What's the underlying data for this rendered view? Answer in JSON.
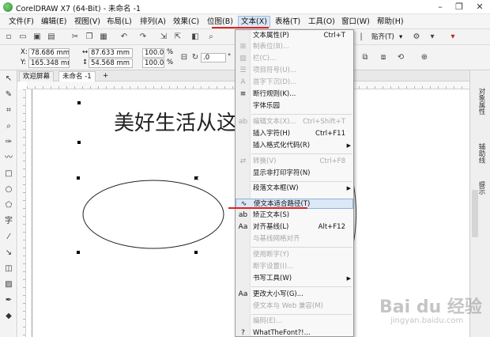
{
  "window": {
    "title": "CorelDRAW X7 (64-Bit) - 未命名 -1",
    "minimize_glyph": "–",
    "restore_glyph": "❐",
    "close_glyph": "✕"
  },
  "menubar": {
    "items": [
      {
        "label": "文件(F)"
      },
      {
        "label": "编辑(E)"
      },
      {
        "label": "视图(V)"
      },
      {
        "label": "布局(L)"
      },
      {
        "label": "排列(A)"
      },
      {
        "label": "效果(C)"
      },
      {
        "label": "位图(B)"
      },
      {
        "label": "文本(X)"
      },
      {
        "label": "表格(T)"
      },
      {
        "label": "工具(O)"
      },
      {
        "label": "窗口(W)"
      },
      {
        "label": "帮助(H)"
      }
    ],
    "active_index": 7
  },
  "toolbar": {
    "icons": [
      "new-icon",
      "open-icon",
      "save-icon",
      "print-icon",
      "cut-icon",
      "copy-icon",
      "paste-icon",
      "undo-icon",
      "redo-icon",
      "import-icon",
      "export-icon",
      "app-launcher-icon",
      "zoom-icon"
    ],
    "snap_label": "贴齐(T)",
    "snap_arrow": "▾"
  },
  "property_bar": {
    "x_label": "X:",
    "x_value": "78.686 mm",
    "y_label": "Y:",
    "y_value": "165.348 mm",
    "w_value": "87.633 mm",
    "h_value": "54.568 mm",
    "scale_w": "100.0",
    "scale_h": "100.0",
    "percent": "%",
    "rotation": ".0",
    "degree": "°"
  },
  "tabs": [
    {
      "label": "欢迎屏幕"
    },
    {
      "label": "未命名 -1"
    }
  ],
  "add_tab_glyph": "+",
  "canvas": {
    "art_text": "美好生活从这",
    "x_marker": "×"
  },
  "docker": {
    "tabs": [
      "对象属性",
      "辅助线",
      "提示"
    ]
  },
  "text_menu": {
    "items": [
      {
        "label": "文本属性(P)",
        "shortcut": "Ctrl+T",
        "disabled": false,
        "icon": ""
      },
      {
        "label": "制表位(B)...",
        "shortcut": "",
        "disabled": true,
        "icon": ""
      },
      {
        "label": "栏(C)...",
        "shortcut": "",
        "disabled": true,
        "icon": ""
      },
      {
        "label": "项目符号(U)...",
        "shortcut": "",
        "disabled": true,
        "icon": "☰"
      },
      {
        "label": "首字下沉(D)...",
        "shortcut": "",
        "disabled": true,
        "icon": "A"
      },
      {
        "label": "断行规则(K)...",
        "shortcut": "",
        "disabled": false,
        "icon": "≡"
      },
      {
        "label": "字体乐园",
        "shortcut": "",
        "disabled": false,
        "icon": ""
      },
      {
        "label": "编辑文本(X)...",
        "shortcut": "Ctrl+Shift+T",
        "disabled": true,
        "icon": ""
      },
      {
        "label": "插入字符(H)",
        "shortcut": "Ctrl+F11",
        "disabled": false,
        "icon": ""
      },
      {
        "label": "插入格式化代码(R)",
        "shortcut": "",
        "disabled": false,
        "icon": "",
        "submenu": true
      },
      {
        "label": "转换(V)",
        "shortcut": "Ctrl+F8",
        "disabled": true,
        "icon": "⇄"
      },
      {
        "label": "显示非打印字符(N)",
        "shortcut": "",
        "disabled": false,
        "icon": ""
      },
      {
        "label": "段落文本框(W)",
        "shortcut": "",
        "disabled": false,
        "icon": "",
        "submenu": true
      },
      {
        "label": "使文本适合路径(T)",
        "shortcut": "",
        "disabled": false,
        "icon": "∿",
        "highlight": true
      },
      {
        "label": "矫正文本(S)",
        "shortcut": "",
        "disabled": false,
        "icon": "ab"
      },
      {
        "label": "对齐基线(L)",
        "shortcut": "Alt+F12",
        "disabled": false,
        "icon": "Aa"
      },
      {
        "label": "与基线网格对齐",
        "shortcut": "",
        "disabled": true,
        "icon": ""
      },
      {
        "label": "使用断字(Y)",
        "shortcut": "",
        "disabled": true,
        "icon": ""
      },
      {
        "label": "断字设置(I)...",
        "shortcut": "",
        "disabled": true,
        "icon": ""
      },
      {
        "label": "书写工具(W)",
        "shortcut": "",
        "disabled": false,
        "icon": "",
        "submenu": true
      },
      {
        "label": "更改大小写(G)...",
        "shortcut": "",
        "disabled": false,
        "icon": "Aa"
      },
      {
        "label": "使文本与 Web 兼容(M)",
        "shortcut": "",
        "disabled": true,
        "icon": ""
      },
      {
        "label": "编码(E)...",
        "shortcut": "",
        "disabled": true,
        "icon": ""
      },
      {
        "label": "WhatTheFont?!...",
        "shortcut": "",
        "disabled": false,
        "icon": "?"
      }
    ]
  },
  "watermark": {
    "brand": "Bai du 经验",
    "url": "jingyan.baidu.com"
  },
  "colors": {
    "accent_red": "#e02222",
    "menu_highlight": "#dce8f6"
  }
}
